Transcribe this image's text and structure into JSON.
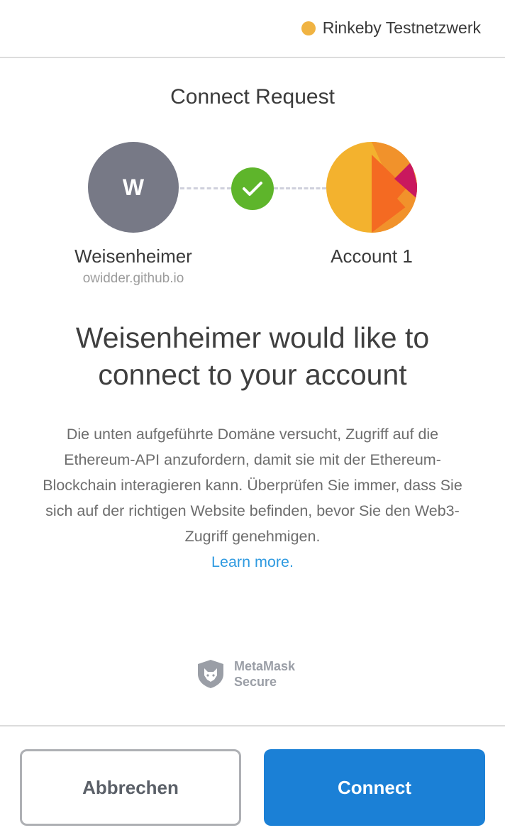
{
  "header": {
    "network_label": "Rinkeby Testnetzwerk",
    "network_color": "#f0b342"
  },
  "title": "Connect Request",
  "site": {
    "initial": "W",
    "name": "Weisenheimer",
    "origin": "owidder.github.io",
    "avatar_color": "#777986"
  },
  "status_icon": "checkmark-icon",
  "account": {
    "name": "Account 1"
  },
  "heading": {
    "line1": "Weisenheimer would like to",
    "line2": "connect to your account"
  },
  "description": {
    "text": "Die unten aufgeführte Domäne versucht, Zugriff auf die Ethereum-API anzufordern, damit sie mit der Ethereum-Blockchain interagieren kann. Überprüfen Sie immer, dass Sie sich auf der richtigen Website befinden, bevor Sie den Web3-Zugriff genehmigen.",
    "learn_more": "Learn more."
  },
  "secure_badge": {
    "line1": "MetaMask",
    "line2": "Secure",
    "icon": "fox-shield-icon"
  },
  "actions": {
    "cancel_label": "Abbrechen",
    "connect_label": "Connect"
  },
  "colors": {
    "accent": "#1b80d6",
    "success": "#5eb52b",
    "link": "#2f9ae0"
  }
}
